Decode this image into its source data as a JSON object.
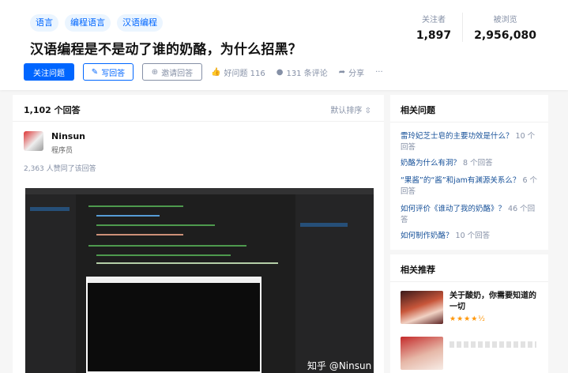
{
  "topics": [
    "语言",
    "编程语言",
    "汉语编程"
  ],
  "question": {
    "title": "汉语编程是不是动了谁的奶酪，为什么招黑？"
  },
  "stats": [
    {
      "label": "关注者",
      "value": "1,897"
    },
    {
      "label": "被浏览",
      "value": "2,956,080"
    }
  ],
  "actions": {
    "follow": "关注问题",
    "write": "写回答",
    "invite": "邀请回答",
    "good": "好问题 116",
    "comments": "131 条评论",
    "share": "分享",
    "more": "···"
  },
  "answers": {
    "count": "1,102 个回答",
    "sort": "默认排序"
  },
  "answer": {
    "author": "Ninsun",
    "author_desc": "程序员",
    "votes": "2,363 人赞同了该回答",
    "watermark": "知乎 @Ninsun"
  },
  "related": {
    "title": "相关问题",
    "items": [
      {
        "q": "雷玲妃芝士皂的主要功效是什么？",
        "count": "10 个回答"
      },
      {
        "q": "奶酪为什么有洞？",
        "count": "8 个回答"
      },
      {
        "q": "“果酱”的“酱”和jam有渊源关系么？",
        "count": "6 个回答"
      },
      {
        "q": "如何评价《谁动了我的奶酪》？",
        "count": "46 个回答"
      },
      {
        "q": "如何制作奶酪？",
        "count": "10 个回答"
      }
    ]
  },
  "recommend": {
    "title": "相关推荐",
    "items": [
      {
        "title": "关于酸奶，你需要知道的一切",
        "stars": "★★★★½"
      }
    ]
  },
  "colors": {
    "brand": "#0066ff",
    "link": "#175199",
    "muted": "#8590a6"
  }
}
